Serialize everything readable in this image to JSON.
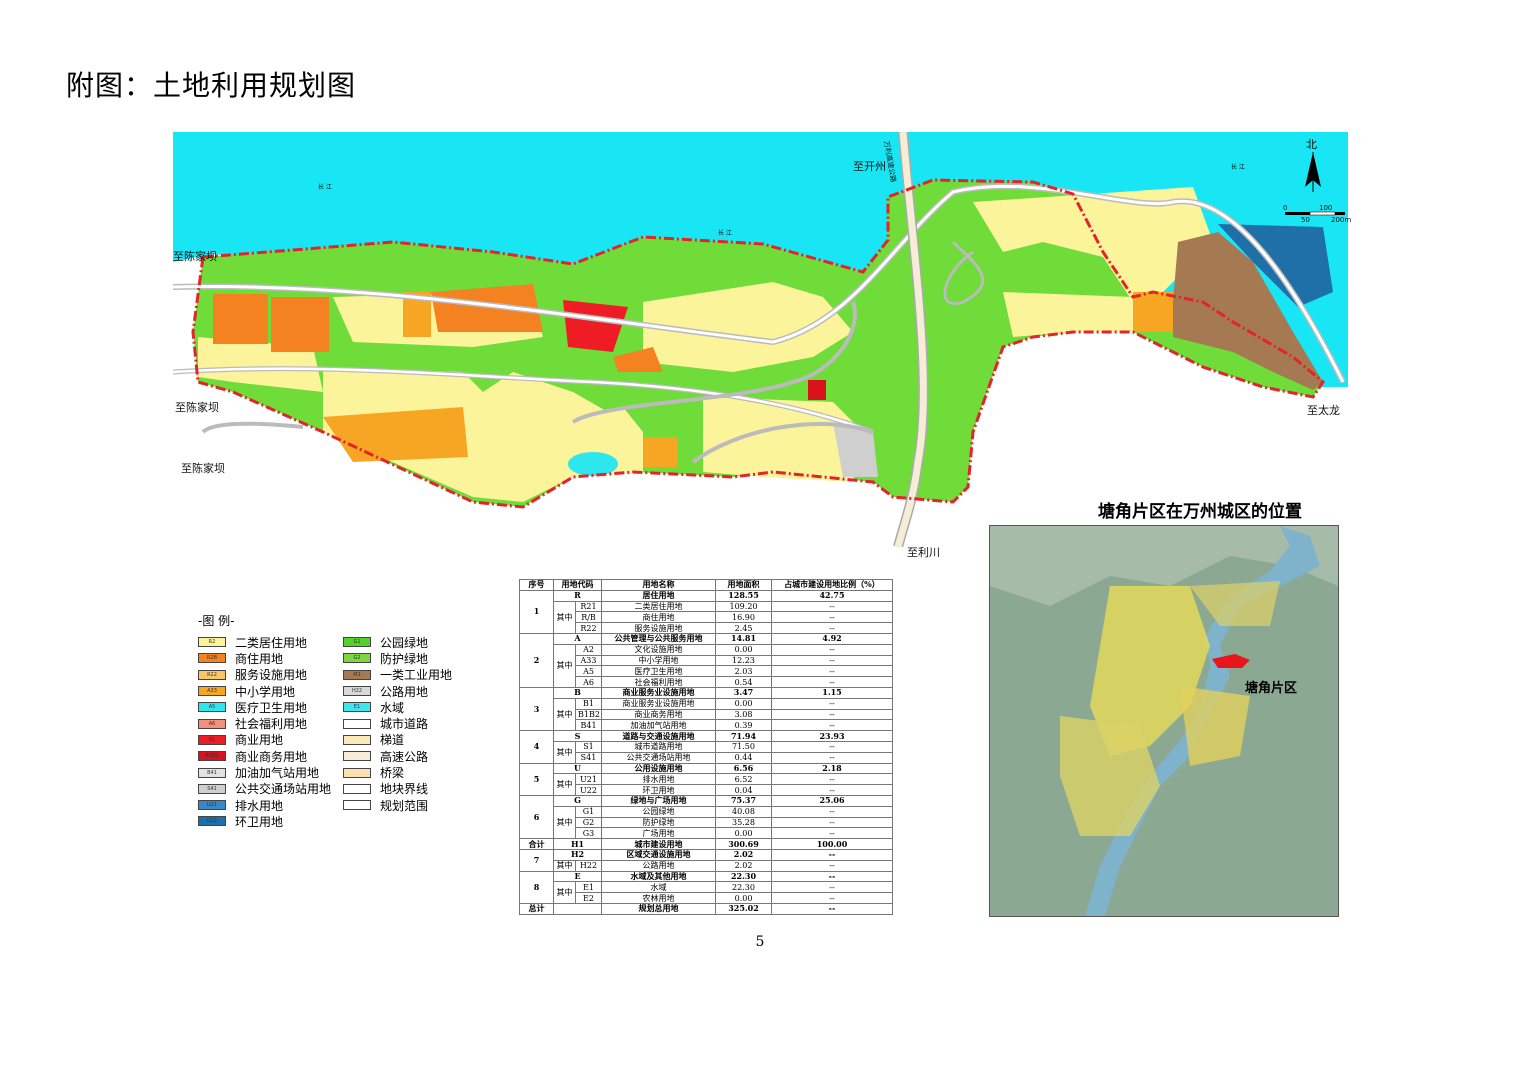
{
  "page_title": "附图：土地利用规划图",
  "map": {
    "north_label": "北",
    "scale_ticks": [
      "0",
      "50",
      "100",
      "200m"
    ],
    "place_labels": [
      {
        "id": "chenjiaba-1",
        "text": "至陈家坝"
      },
      {
        "id": "chenjiaba-2",
        "text": "至陈家坝"
      },
      {
        "id": "chenjiaba-3",
        "text": "至陈家坝"
      },
      {
        "id": "kaizhou",
        "text": "至开州"
      },
      {
        "id": "lichuan",
        "text": "至利川"
      },
      {
        "id": "tailong",
        "text": "至太龙"
      },
      {
        "id": "river-1",
        "text": "长 江"
      },
      {
        "id": "river-2",
        "text": "长 江"
      },
      {
        "id": "river-3",
        "text": "长 江"
      },
      {
        "id": "expressway",
        "text": "万利高速公路"
      }
    ]
  },
  "inset": {
    "title": "塘角片区在万州城区的位置",
    "label": "塘角片区"
  },
  "legend": {
    "title": "-图 例-",
    "items_left": [
      {
        "code": "R2",
        "label": "二类居住用地",
        "color": "#fbf49a"
      },
      {
        "code": "R2B",
        "label": "商住用地",
        "color": "#f58220"
      },
      {
        "code": "R22",
        "label": "服务设施用地",
        "color": "#fbc56a"
      },
      {
        "code": "A33",
        "label": "中小学用地",
        "color": "#f6a623"
      },
      {
        "code": "A5",
        "label": "医疗卫生用地",
        "color": "#2ee6ee"
      },
      {
        "code": "A6",
        "label": "社会福利用地",
        "color": "#f4907a"
      },
      {
        "code": "B1",
        "label": "商业用地",
        "color": "#ee1c24"
      },
      {
        "code": "B1B2",
        "label": "商业商务用地",
        "color": "#d9121e"
      },
      {
        "code": "B41",
        "label": "加油加气站用地",
        "color": "#e3e3e3"
      },
      {
        "code": "S41",
        "label": "公共交通场站用地",
        "color": "#cfcfcf"
      },
      {
        "code": "U21",
        "label": "排水用地",
        "color": "#3a86c8"
      },
      {
        "code": "U22",
        "label": "环卫用地",
        "color": "#1f6fa8"
      }
    ],
    "items_right": [
      {
        "code": "G1",
        "label": "公园绿地",
        "color": "#55d22a"
      },
      {
        "code": "G2",
        "label": "防护绿地",
        "color": "#7bd640"
      },
      {
        "code": "M1",
        "label": "一类工业用地",
        "color": "#a57a52"
      },
      {
        "code": "H22",
        "label": "公路用地",
        "color": "#d9d9d9"
      },
      {
        "code": "E1",
        "label": "水域",
        "color": "#3fe6f2"
      },
      {
        "code": "",
        "label": "城市道路",
        "color": "#ffffff"
      },
      {
        "code": "",
        "label": "梯道",
        "color": "#fde9b8"
      },
      {
        "code": "",
        "label": "高速公路",
        "color": "#f6edd7"
      },
      {
        "code": "",
        "label": "桥梁",
        "color": "#fce2b0"
      },
      {
        "code": "",
        "label": "地块界线",
        "color": "#ffffff"
      },
      {
        "code": "",
        "label": "规划范围",
        "color": "#ffffff"
      }
    ]
  },
  "table": {
    "headers": [
      "序号",
      "用地代码",
      "用地名称",
      "用地面积",
      "占城市建设用地比例（%）"
    ],
    "rows": [
      [
        "1",
        "",
        "R",
        "居住用地",
        "128.55",
        "42.75"
      ],
      [
        "",
        "其中",
        "R21",
        "二类居住用地",
        "109.20",
        "--"
      ],
      [
        "",
        "",
        "R/B",
        "商住用地",
        "16.90",
        "--"
      ],
      [
        "",
        "",
        "R22",
        "服务设施用地",
        "2.45",
        "--"
      ],
      [
        "2",
        "",
        "A",
        "公共管理与公共服务用地",
        "14.81",
        "4.92"
      ],
      [
        "",
        "其中",
        "A2",
        "文化设施用地",
        "0.00",
        "--"
      ],
      [
        "",
        "",
        "A33",
        "中小学用地",
        "12.23",
        "--"
      ],
      [
        "",
        "",
        "A5",
        "医疗卫生用地",
        "2.03",
        "--"
      ],
      [
        "",
        "",
        "A6",
        "社会福利用地",
        "0.54",
        "--"
      ],
      [
        "3",
        "",
        "B",
        "商业服务业设施用地",
        "3.47",
        "1.15"
      ],
      [
        "",
        "其中",
        "B1",
        "商业服务业设施用地",
        "0.00",
        "--"
      ],
      [
        "",
        "",
        "B1B2",
        "商业商务用地",
        "3.08",
        "--"
      ],
      [
        "",
        "",
        "B41",
        "加油加气站用地",
        "0.39",
        "--"
      ],
      [
        "4",
        "",
        "S",
        "道路与交通设施用地",
        "71.94",
        "23.93"
      ],
      [
        "",
        "其中",
        "S1",
        "城市道路用地",
        "71.50",
        "--"
      ],
      [
        "",
        "",
        "S41",
        "公共交通场站用地",
        "0.44",
        "--"
      ],
      [
        "5",
        "",
        "U",
        "公用设施用地",
        "6.56",
        "2.18"
      ],
      [
        "",
        "其中",
        "U21",
        "排水用地",
        "6.52",
        "--"
      ],
      [
        "",
        "",
        "U22",
        "环卫用地",
        "0.04",
        "--"
      ],
      [
        "6",
        "",
        "G",
        "绿地与广场用地",
        "75.37",
        "25.06"
      ],
      [
        "",
        "其中",
        "G1",
        "公园绿地",
        "40.08",
        "--"
      ],
      [
        "",
        "",
        "G2",
        "防护绿地",
        "35.28",
        "--"
      ],
      [
        "",
        "",
        "G3",
        "广场用地",
        "0.00",
        "--"
      ],
      [
        "合计",
        "",
        "H1",
        "城市建设用地",
        "300.69",
        "100.00"
      ],
      [
        "7",
        "",
        "H2",
        "区域交通设施用地",
        "2.02",
        "--"
      ],
      [
        "",
        "其中",
        "H22",
        "公路用地",
        "2.02",
        "--"
      ],
      [
        "8",
        "",
        "E",
        "水域及其他用地",
        "22.30",
        "--"
      ],
      [
        "",
        "其中",
        "E1",
        "水域",
        "22.30",
        "--"
      ],
      [
        "",
        "",
        "E2",
        "农林用地",
        "0.00",
        "--"
      ],
      [
        "总计",
        "",
        "",
        "规划总用地",
        "325.02",
        "--"
      ]
    ]
  },
  "page_number": "5"
}
